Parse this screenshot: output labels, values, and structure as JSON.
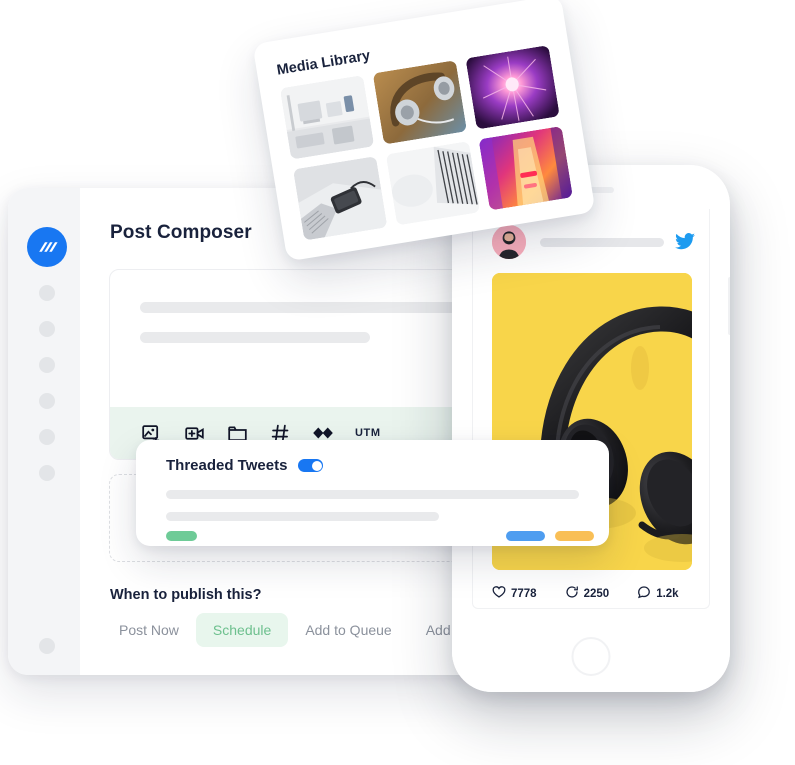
{
  "app": {
    "logo_icon": "wave-logo-icon",
    "accent_blue": "#1877f2",
    "accent_green": "#6dc08e",
    "toolbar_bg": "#eaf4ee",
    "media_yellow": "#f8d54a"
  },
  "sidebar": {
    "items": [
      {
        "name": "nav-dot-1"
      },
      {
        "name": "nav-dot-2"
      },
      {
        "name": "nav-dot-3"
      },
      {
        "name": "nav-dot-4"
      },
      {
        "name": "nav-dot-5"
      },
      {
        "name": "nav-dot-6"
      },
      {
        "name": "nav-dot-7"
      }
    ]
  },
  "composer": {
    "title": "Post Composer",
    "placeholder_lines": 2,
    "toolbar": {
      "items": [
        {
          "icon": "add-image-icon",
          "label": ""
        },
        {
          "icon": "add-video-icon",
          "label": ""
        },
        {
          "icon": "folder-icon",
          "label": ""
        },
        {
          "icon": "hashtag-icon",
          "label": ""
        },
        {
          "icon": "sparkle-diamond-icon",
          "label": ""
        },
        {
          "icon": "utm-icon",
          "label": "UTM"
        }
      ]
    },
    "publish_question": "When to publish this?",
    "publish_tabs": [
      {
        "label": "Post Now",
        "active": false
      },
      {
        "label": "Schedule",
        "active": true
      },
      {
        "label": "Add to Queue",
        "active": false
      },
      {
        "label": "Add to Content Calendar",
        "active": false
      }
    ]
  },
  "media_library": {
    "title": "Media Library",
    "thumbnails": [
      {
        "name": "thumb-desk-setup"
      },
      {
        "name": "thumb-silver-headphones"
      },
      {
        "name": "thumb-plasma-ball"
      },
      {
        "name": "thumb-phone-on-laptop"
      },
      {
        "name": "thumb-laptop-keyboard"
      },
      {
        "name": "thumb-neon-corridor"
      }
    ]
  },
  "threaded_tweets": {
    "title": "Threaded Tweets",
    "toggle_on": true,
    "toggle_icon": "toggle-switch-icon"
  },
  "phone_preview": {
    "network_icon": "twitter-bird-icon",
    "avatar_name": "user-avatar",
    "media_name": "yellow-headphones-photo",
    "stats": [
      {
        "icon": "heart-icon",
        "value": "7778"
      },
      {
        "icon": "retweet-icon",
        "value": "2250"
      },
      {
        "icon": "comment-icon",
        "value": "1.2k"
      }
    ],
    "home_button": "home-button"
  }
}
